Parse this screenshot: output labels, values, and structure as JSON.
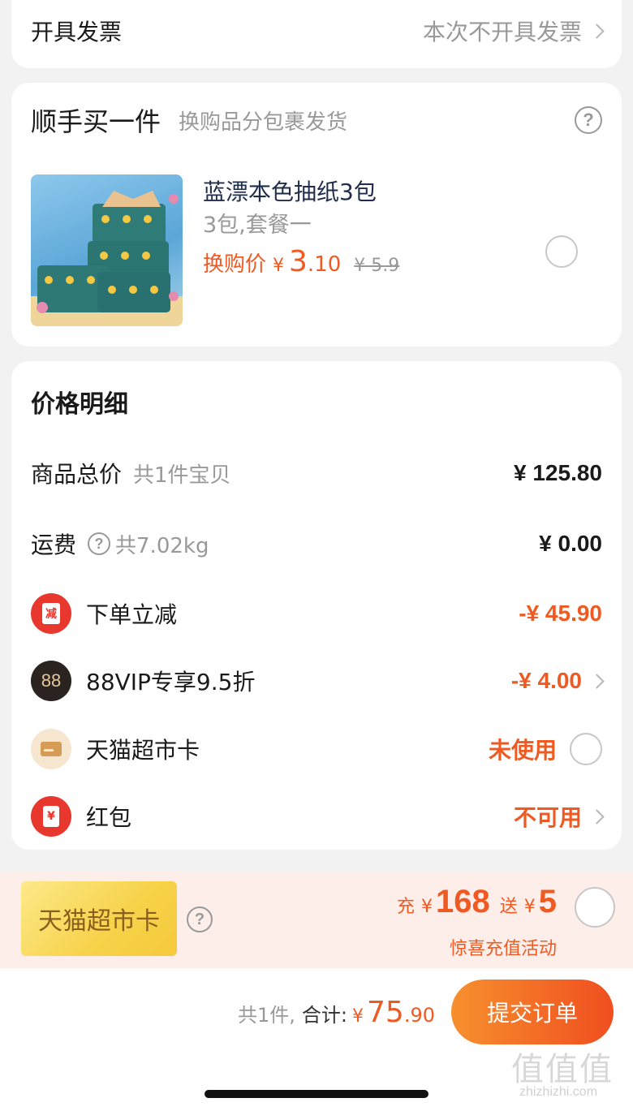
{
  "invoice": {
    "label": "开具发票",
    "value": "本次不开具发票"
  },
  "addon": {
    "title": "顺手买一件",
    "subtitle": "换购品分包裹发货",
    "product": {
      "name": "蓝漂本色抽纸3包",
      "spec": "3包,套餐一",
      "price_label": "换购价",
      "currency": "¥",
      "price_int": "3",
      "price_dec": ".10",
      "original_price": "¥ 5.9"
    }
  },
  "price_detail": {
    "title": "价格明细",
    "goods_total": {
      "label": "商品总价",
      "note": "共1件宝贝",
      "value": "¥ 125.80"
    },
    "shipping": {
      "label": "运费",
      "note": "共7.02kg",
      "value": "¥ 0.00"
    },
    "discount": {
      "icon_text": "减",
      "label": "下单立减",
      "value": "-¥ 45.90"
    },
    "vip": {
      "icon_text": "88",
      "label": "88VIP专享9.5折",
      "value": "-¥ 4.00"
    },
    "supermarket_card": {
      "label": "天猫超市卡",
      "value": "未使用"
    },
    "red_packet": {
      "icon_text": "¥",
      "label": "红包",
      "value": "不可用"
    }
  },
  "promo": {
    "badge": "天猫超市卡",
    "charge_label": "充",
    "charge_currency": "¥",
    "charge_amount": "168",
    "gift_label": "送",
    "gift_currency": "¥",
    "gift_amount": "5",
    "subtitle": "惊喜充值活动"
  },
  "footer": {
    "count": "共1件,",
    "total_label": "合计:",
    "currency": "¥",
    "total_int": "75",
    "total_dec": ".90",
    "submit": "提交订单"
  },
  "watermark": {
    "glyphs": "值值值",
    "url": "zhizhizhi.com"
  },
  "colors": {
    "accent": "#ef5a22",
    "submit_gradient_start": "#f7902e",
    "submit_gradient_end": "#f04e1f"
  }
}
